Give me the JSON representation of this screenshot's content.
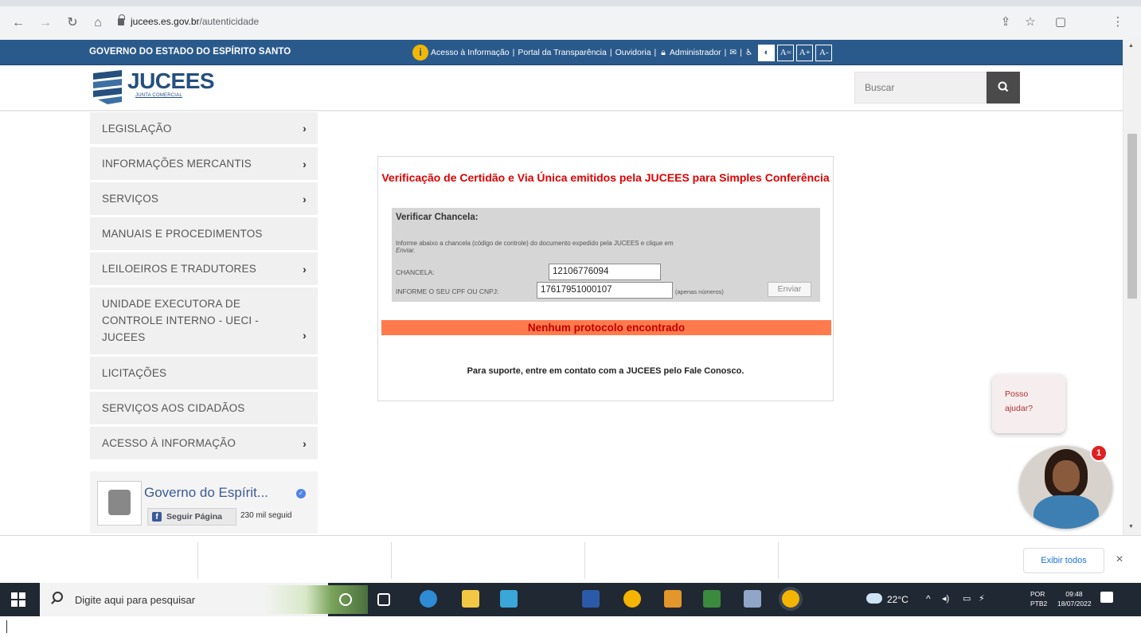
{
  "browser": {
    "url_domain": "jucees.es.gov.br",
    "url_path": "/autenticidade"
  },
  "gov_bar": {
    "title": "GOVERNO DO ESTADO DO ESPÍRITO SANTO",
    "link_info": "Acesso à Informação",
    "link_transparency": "Portal da Transparência",
    "link_ombudsman": "Ouvidoria",
    "link_admin": "Administrador",
    "sep": "|",
    "acc_contrast": "",
    "acc_font_reset": "A=",
    "acc_font_up": "A+",
    "acc_font_down": "A-"
  },
  "header": {
    "logo_text": "JUCEES",
    "logo_sub": "JUNTA COMERCIAL",
    "search_placeholder": "Buscar"
  },
  "sidebar": {
    "items": [
      {
        "label": "LEGISLAÇÃO",
        "chevron": "›"
      },
      {
        "label": "INFORMAÇÕES MERCANTIS",
        "chevron": "›"
      },
      {
        "label": "SERVIÇOS",
        "chevron": "›"
      },
      {
        "label": "MANUAIS E PROCEDIMENTOS",
        "chevron": ""
      },
      {
        "label": "LEILOEIROS E TRADUTORES",
        "chevron": "›"
      },
      {
        "label": "UNIDADE EXECUTORA DE CONTROLE INTERNO - UECI - JUCEES",
        "chevron": "›"
      },
      {
        "label": "LICITAÇÕES",
        "chevron": ""
      },
      {
        "label": "SERVIÇOS AOS CIDADÃOS",
        "chevron": ""
      },
      {
        "label": "ACESSO À INFORMAÇÃO",
        "chevron": "›"
      }
    ]
  },
  "facebook": {
    "page_name": "Governo do Espírit...",
    "follow_label": "Seguir Página",
    "followers": "230 mil seguid"
  },
  "panel": {
    "title": "Verificação de Certidão e Via Única emitidos pela JUCEES para Simples Conferência",
    "form_heading": "Verificar Chancela:",
    "instructions": "Informe abaixo a chancela (código de controle) do documento expedido pela JUCEES e clique em",
    "instructions_em": "Enviar.",
    "chancela_label": "CHANCELA:",
    "chancela_value": "12106776094",
    "cpf_label": "INFORME O SEU CPF OU CNPJ:",
    "cpf_value": "17617951000107",
    "cpf_hint": "(apenas números)",
    "submit_label": "Enviar",
    "result": "Nenhum protocolo encontrado",
    "support": "Para suporte, entre em contato com a JUCEES pelo Fale Conosco."
  },
  "chat": {
    "bubble_line1": "Posso",
    "bubble_line2": "ajudar?",
    "badge": "1"
  },
  "download_bar": {
    "show_all": "Exibir todos",
    "close": "×"
  },
  "taskbar": {
    "search_placeholder": "Digite aqui para pesquisar",
    "temperature": "22°C",
    "lang_top": "POR",
    "lang_bottom": "PTB2",
    "time": "09:48",
    "date": "18/07/2022"
  },
  "colors": {
    "gov_bar": "#2a5a8c",
    "title_red": "#e00000",
    "result_bar": "#ff7a4d",
    "result_text": "#c00000"
  }
}
